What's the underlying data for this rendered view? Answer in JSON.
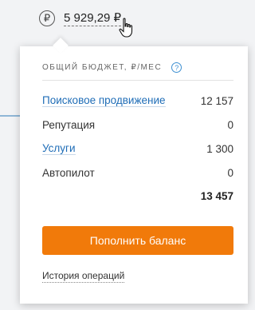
{
  "balance": {
    "currency_symbol": "₽",
    "value": "5 929,29 ₽"
  },
  "dropdown": {
    "header_title": "ОБЩИЙ БЮДЖЕТ, ₽/МЕС",
    "help_symbol": "?",
    "items": [
      {
        "label": "Поисковое продвижение",
        "amount": "12 157",
        "is_link": true
      },
      {
        "label": "Репутация",
        "amount": "0",
        "is_link": false
      },
      {
        "label": "Услуги",
        "amount": "1 300",
        "is_link": true
      },
      {
        "label": "Автопилот",
        "amount": "0",
        "is_link": false
      }
    ],
    "total": "13 457",
    "topup_button": "Пополнить баланс",
    "history_link": "История операций"
  },
  "colors": {
    "accent_orange": "#f17a0a",
    "link_blue": "#1f6db7"
  }
}
